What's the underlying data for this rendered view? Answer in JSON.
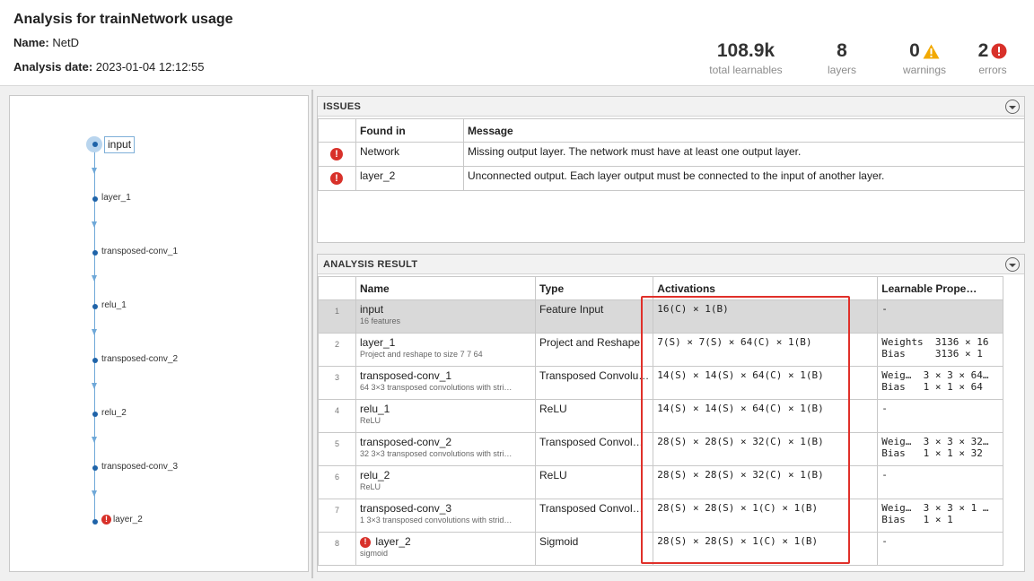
{
  "header": {
    "title": "Analysis for trainNetwork usage",
    "name_label": "Name:",
    "name_value": "NetD",
    "date_label": "Analysis date:",
    "date_value": "2023-01-04 12:12:55"
  },
  "stats": {
    "learnables": {
      "value": "108.9k",
      "label": "total learnables"
    },
    "layers": {
      "value": "8",
      "label": "layers"
    },
    "warnings": {
      "value": "0",
      "label": "warnings",
      "icon": "warning-icon",
      "color": "#f2a900"
    },
    "errors": {
      "value": "2",
      "label": "errors",
      "icon": "error-icon",
      "color": "#d8312a"
    }
  },
  "graph": {
    "nodes": [
      "input",
      "layer_1",
      "transposed-conv_1",
      "relu_1",
      "transposed-conv_2",
      "relu_2",
      "transposed-conv_3",
      "layer_2"
    ]
  },
  "issues": {
    "title": "ISSUES",
    "col_found": "Found in",
    "col_message": "Message",
    "rows": [
      {
        "found": "Network",
        "message": "Missing output layer. The network must have at least one output layer."
      },
      {
        "found": "layer_2",
        "message": "Unconnected output. Each layer output must be connected to the input of another layer."
      }
    ]
  },
  "result": {
    "title": "ANALYSIS RESULT",
    "col_name": "Name",
    "col_type": "Type",
    "col_activations": "Activations",
    "col_learnables": "Learnable Prope…",
    "rows": [
      {
        "idx": "1",
        "name": "input",
        "desc": "16 features",
        "type": "Feature Input",
        "act": "16(C) × 1(B)",
        "learn1": "-",
        "learn2": ""
      },
      {
        "idx": "2",
        "name": "layer_1",
        "desc": "Project and reshape to size 7 7 64",
        "type": "Project and Reshape",
        "act": "7(S) × 7(S) × 64(C) × 1(B)",
        "learn1": "Weights  3136 × 16",
        "learn2": "Bias     3136 × 1"
      },
      {
        "idx": "3",
        "name": "transposed-conv_1",
        "desc": "64 3×3 transposed convolutions with stri…",
        "type": "Transposed Convolu…",
        "act": "14(S) × 14(S) × 64(C) × 1(B)",
        "learn1": "Weig…  3 × 3 × 64…",
        "learn2": "Bias   1 × 1 × 64"
      },
      {
        "idx": "4",
        "name": "relu_1",
        "desc": "ReLU",
        "type": "ReLU",
        "act": "14(S) × 14(S) × 64(C) × 1(B)",
        "learn1": "-",
        "learn2": ""
      },
      {
        "idx": "5",
        "name": "transposed-conv_2",
        "desc": "32 3×3 transposed convolutions with stri…",
        "type": "Transposed Convol…",
        "act": "28(S) × 28(S) × 32(C) × 1(B)",
        "learn1": "Weig…  3 × 3 × 32…",
        "learn2": "Bias   1 × 1 × 32"
      },
      {
        "idx": "6",
        "name": "relu_2",
        "desc": "ReLU",
        "type": "ReLU",
        "act": "28(S) × 28(S) × 32(C) × 1(B)",
        "learn1": "-",
        "learn2": ""
      },
      {
        "idx": "7",
        "name": "transposed-conv_3",
        "desc": "1 3×3 transposed convolutions with strid…",
        "type": "Transposed Convol…",
        "act": "28(S) × 28(S) × 1(C) × 1(B)",
        "learn1": "Weig…  3 × 3 × 1 …",
        "learn2": "Bias   1 × 1"
      },
      {
        "idx": "8",
        "name": "layer_2",
        "desc": "sigmoid",
        "type": "Sigmoid",
        "act": "28(S) × 28(S) × 1(C) × 1(B)",
        "learn1": "-",
        "learn2": ""
      }
    ]
  }
}
